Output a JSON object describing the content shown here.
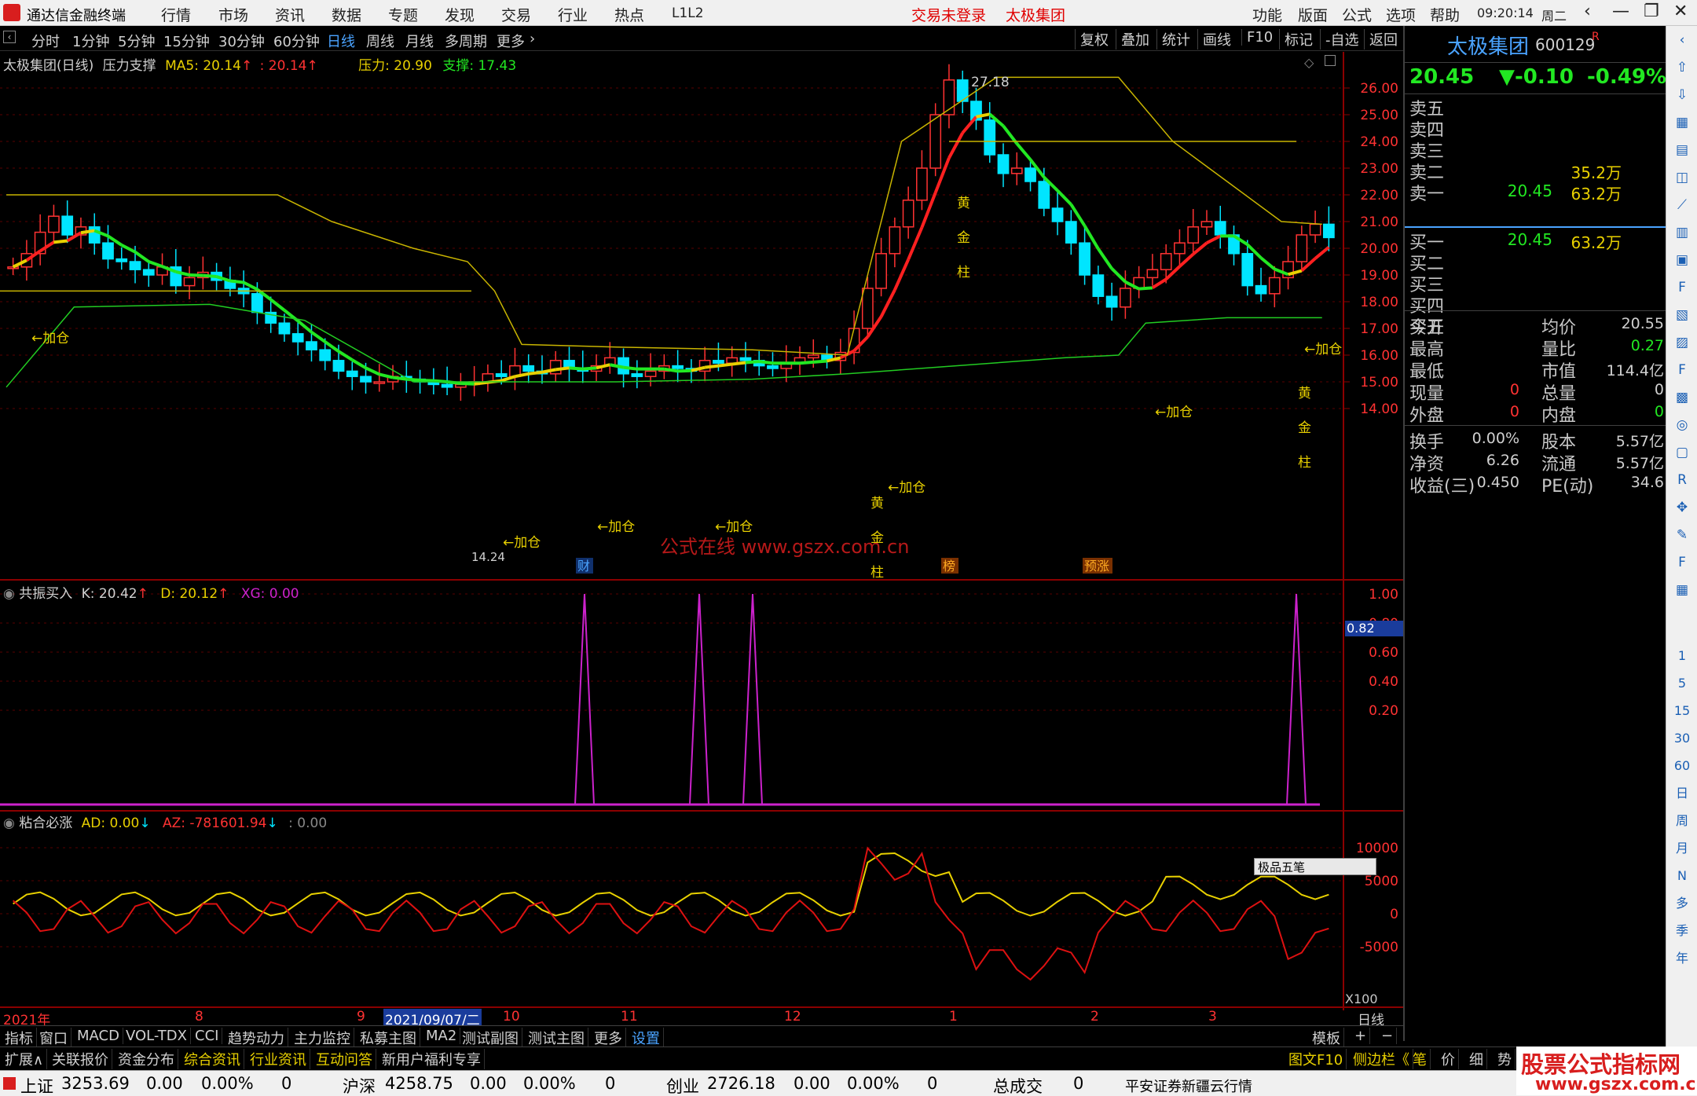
{
  "window": {
    "app_name": "通达信金融终端",
    "menu": [
      "行情",
      "市场",
      "资讯",
      "数据",
      "专题",
      "发现",
      "交易",
      "行业",
      "热点",
      "L1L2"
    ],
    "login_status": "交易未登录",
    "stock_title": "太极集团",
    "right_menu": [
      "功能",
      "版面",
      "公式",
      "选项",
      "帮助"
    ],
    "time": "09:20:14",
    "weekday": "周二"
  },
  "periods": [
    "分时",
    "1分钟",
    "5分钟",
    "15分钟",
    "30分钟",
    "60分钟",
    "日线",
    "周线",
    "月线",
    "多周期",
    "更多"
  ],
  "active_period": "日线",
  "right_tools": [
    "复权",
    "叠加",
    "统计",
    "画线",
    "F10",
    "标记",
    "-自选",
    "返回"
  ],
  "main_chart": {
    "title": "太极集团(日线)",
    "indicator": "压力支撑",
    "ma5_label": "MA5: 20.14",
    "ma5_arrow": "↑",
    "ma_extra": ": 20.14",
    "pressure": "压力: 20.90",
    "support": "支撑: 17.43",
    "price_ticks": [
      "26.00",
      "25.00",
      "24.00",
      "23.00",
      "22.00",
      "21.00",
      "20.00",
      "19.00",
      "18.00",
      "17.00",
      "16.00",
      "15.00",
      "14.00"
    ],
    "high_label": "27.18",
    "low_label": "14.24",
    "watermark": "公式在线  www.gszx.com.cn",
    "markers": [
      {
        "t": "←加仓"
      },
      {
        "t": "←加仓"
      },
      {
        "t": "←加仓"
      },
      {
        "t": "←加仓"
      },
      {
        "t": "←加仓"
      },
      {
        "t": "←加仓"
      },
      {
        "t": "←加仓"
      },
      {
        "t": "黄"
      },
      {
        "t": "金"
      },
      {
        "t": "柱"
      }
    ],
    "flags": [
      "财",
      "榜",
      "预涨"
    ]
  },
  "sub1": {
    "title": "共振买入",
    "k": "K: 20.42",
    "d": "D: 20.12",
    "xg": "XG: 0.00",
    "ticks": [
      "1.00",
      "0.80",
      "0.60",
      "0.40",
      "0.20"
    ],
    "cursor_value": "0.82"
  },
  "sub2": {
    "title": "粘合必涨",
    "ad": "AD: 0.00",
    "az": "AZ: -781601.94",
    "extra": ": 0.00",
    "ticks": [
      "10000",
      "5000",
      "0",
      "-5000"
    ],
    "scale": "X100",
    "ime": "极品五笔"
  },
  "date_axis": {
    "labels": [
      "2021年",
      "8",
      "9",
      "2021/09/07/二",
      "10",
      "11",
      "12",
      "1",
      "2",
      "3"
    ],
    "period": "日线"
  },
  "bottom_tabs": [
    "指标",
    "窗口",
    "MACD",
    "VOL-TDX",
    "CCI",
    "趋势动力",
    "主力监控",
    "私募主图",
    "MA2",
    "测试副图",
    "测试主图",
    "更多",
    "设置"
  ],
  "bottom_tabs_right": [
    "模板",
    "+",
    "−"
  ],
  "bottom_tabs2": [
    "扩展∧",
    "关联报价",
    "资金分布",
    "综合资讯",
    "行业资讯",
    "互动问答",
    "新用户福利专享"
  ],
  "bottom_tabs2_right": [
    "图文F10",
    "侧边栏《",
    "笔",
    "价",
    "细",
    "势"
  ],
  "quote": {
    "name": "太极集团",
    "code": "600129",
    "flag": "R",
    "price": "20.45",
    "change": "▼-0.10",
    "pct": "-0.49%",
    "sells": [
      {
        "label": "卖五",
        "price": "",
        "vol": ""
      },
      {
        "label": "卖四",
        "price": "",
        "vol": ""
      },
      {
        "label": "卖三",
        "price": "",
        "vol": ""
      },
      {
        "label": "卖二",
        "price": "",
        "vol": "35.2万"
      },
      {
        "label": "卖一",
        "price": "20.45",
        "vol": "63.2万"
      }
    ],
    "buys": [
      {
        "label": "买一",
        "price": "20.45",
        "vol": "63.2万"
      },
      {
        "label": "买二",
        "price": "",
        "vol": ""
      },
      {
        "label": "买三",
        "price": "",
        "vol": ""
      },
      {
        "label": "买四",
        "price": "",
        "vol": ""
      },
      {
        "label": "买五",
        "price": "",
        "vol": ""
      }
    ],
    "stats": [
      {
        "l1": "今开",
        "v1": "",
        "l2": "均价",
        "v2": "20.55"
      },
      {
        "l1": "最高",
        "v1": "",
        "l2": "量比",
        "v2": "0.27"
      },
      {
        "l1": "最低",
        "v1": "",
        "l2": "市值",
        "v2": "114.4亿"
      },
      {
        "l1": "现量",
        "v1": "0",
        "l2": "总量",
        "v2": "0"
      },
      {
        "l1": "外盘",
        "v1": "0",
        "l2": "内盘",
        "v2": "0"
      }
    ],
    "fin": [
      {
        "l1": "换手",
        "v1": "0.00%",
        "l2": "股本",
        "v2": "5.57亿"
      },
      {
        "l1": "净资",
        "v1": "6.26",
        "l2": "流通",
        "v2": "5.57亿"
      },
      {
        "l1": "收益(三)",
        "v1": "0.450",
        "l2": "PE(动)",
        "v2": "34.6"
      }
    ]
  },
  "status": {
    "sh_name": "上证",
    "sh_val": "3253.69",
    "sh_chg": "0.00",
    "sh_pct": "0.00%",
    "sh_vol": "0",
    "sz_name": "沪深",
    "sz_val": "4258.75",
    "sz_chg": "0.00",
    "sz_pct": "0.00%",
    "sz_vol": "0",
    "cy_name": "创业",
    "cy_val": "2726.18",
    "cy_chg": "0.00",
    "cy_pct": "0.00%",
    "cy_vol": "0",
    "total_label": "总成交",
    "total_val": "0",
    "broker": "平安证券新疆云行情"
  },
  "site_watermark": {
    "title": "股票公式指标网",
    "url": "www.gszx.com.cn"
  },
  "colors": {
    "up": "#ff3232",
    "down": "#00e5ff",
    "ma_green": "#22e822",
    "ma_yellow": "#e8d000",
    "grid": "#8b0000",
    "magenta": "#cc22cc",
    "accent_blue": "#4aa3ff"
  }
}
